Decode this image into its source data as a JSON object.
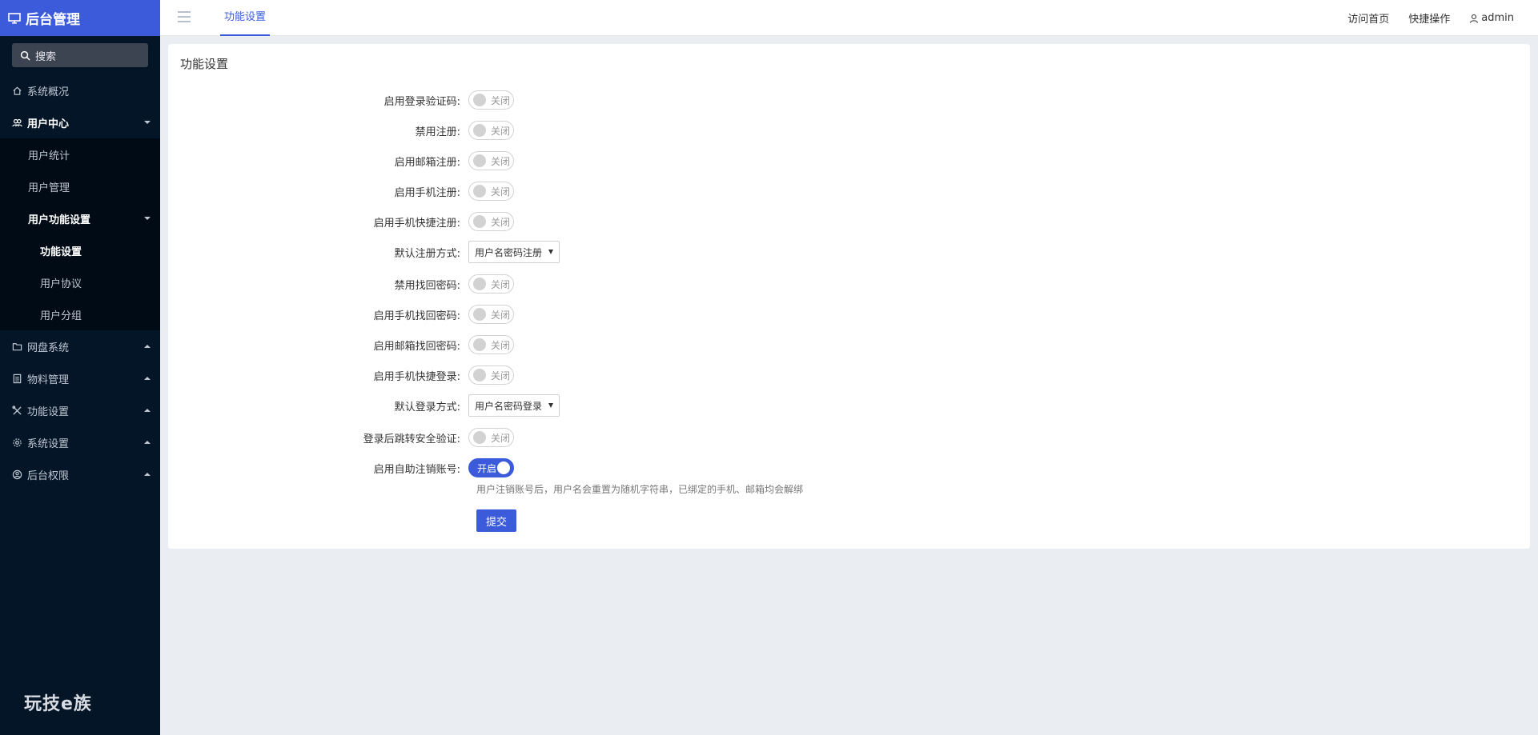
{
  "brand": {
    "title": "后台管理"
  },
  "search": {
    "label": "搜索"
  },
  "sidebar": {
    "items": [
      {
        "label": "系统概况"
      },
      {
        "label": "用户中心"
      },
      {
        "label": "用户统计"
      },
      {
        "label": "用户管理"
      },
      {
        "label": "用户功能设置"
      },
      {
        "label": "功能设置"
      },
      {
        "label": "用户协议"
      },
      {
        "label": "用户分组"
      },
      {
        "label": "网盘系统"
      },
      {
        "label": "物料管理"
      },
      {
        "label": "功能设置"
      },
      {
        "label": "系统设置"
      },
      {
        "label": "后台权限"
      }
    ],
    "footer_logo": "玩技e族"
  },
  "header": {
    "tab": "功能设置",
    "links": [
      "访问首页",
      "快捷操作",
      "admin"
    ]
  },
  "card": {
    "title": "功能设置"
  },
  "form": {
    "rows": [
      {
        "label": "启用登录验证码:",
        "value": "关闭"
      },
      {
        "label": "禁用注册:",
        "value": "关闭"
      },
      {
        "label": "启用邮箱注册:",
        "value": "关闭"
      },
      {
        "label": "启用手机注册:",
        "value": "关闭"
      },
      {
        "label": "启用手机快捷注册:",
        "value": "关闭"
      },
      {
        "label": "默认注册方式:",
        "value": "用户名密码注册"
      },
      {
        "label": "禁用找回密码:",
        "value": "关闭"
      },
      {
        "label": "启用手机找回密码:",
        "value": "关闭"
      },
      {
        "label": "启用邮箱找回密码:",
        "value": "关闭"
      },
      {
        "label": "启用手机快捷登录:",
        "value": "关闭"
      },
      {
        "label": "默认登录方式:",
        "value": "用户名密码登录"
      },
      {
        "label": "登录后跳转安全验证:",
        "value": "关闭"
      },
      {
        "label": "启用自助注销账号:",
        "value": "开启"
      }
    ],
    "hint": "用户注销账号后，用户名会重置为随机字符串，已绑定的手机、邮箱均会解绑",
    "submit": "提交"
  },
  "colors": {
    "accent": "#3b5bdb",
    "sidebar_bg": "#041527"
  }
}
